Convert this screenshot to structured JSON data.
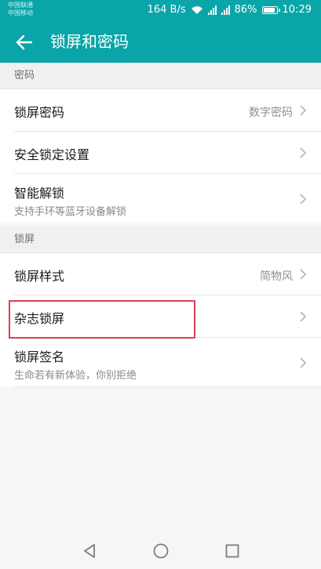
{
  "status_bar": {
    "carrier1": "中国联通",
    "carrier2": "中国移动",
    "speed": "164 B/s",
    "battery": "86%",
    "time": "10:29"
  },
  "app_bar": {
    "title": "锁屏和密码"
  },
  "sections": {
    "password": {
      "header": "密码",
      "lock_password": {
        "label": "锁屏密码",
        "value": "数字密码"
      },
      "security_lock": {
        "label": "安全锁定设置"
      },
      "smart_unlock": {
        "label": "智能解锁",
        "subtitle": "支持手环等蓝牙设备解锁"
      }
    },
    "lockscreen": {
      "header": "锁屏",
      "style": {
        "label": "锁屏样式",
        "value": "简物风"
      },
      "magazine": {
        "label": "杂志锁屏"
      },
      "signature": {
        "label": "锁屏签名",
        "subtitle": "生命若有新体验，你别拒绝"
      }
    }
  },
  "colors": {
    "accent": "#0aa5a8",
    "highlight": "#d9434e"
  }
}
